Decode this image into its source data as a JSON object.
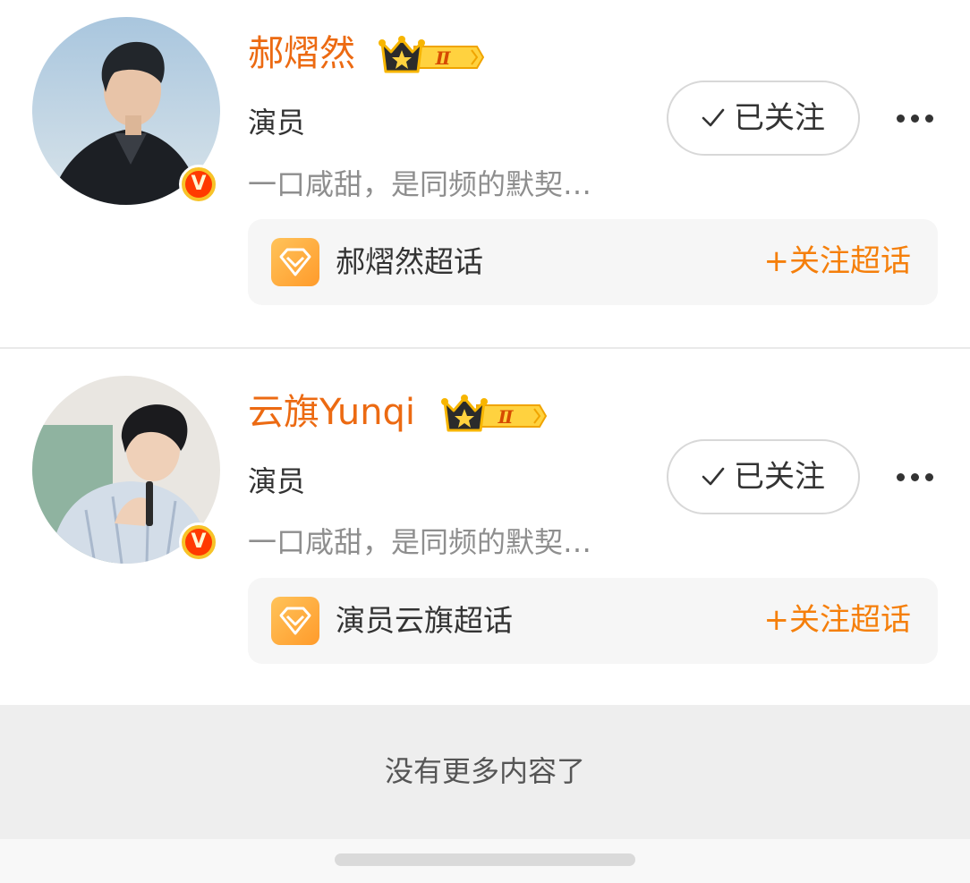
{
  "users": [
    {
      "name": "郝熠然",
      "role": "演员",
      "bio": "一口咸甜，是同频的默契…",
      "level_badge": "Ⅱ",
      "follow_label": "已关注",
      "topic_name": "郝熠然超话",
      "topic_follow_label": "+关注超话"
    },
    {
      "name": "云旗Yunqi",
      "role": "演员",
      "bio": "一口咸甜，是同频的默契…",
      "level_badge": "Ⅱ",
      "follow_label": "已关注",
      "topic_name": "演员云旗超话",
      "topic_follow_label": "+关注超话"
    }
  ],
  "footer": {
    "end_text": "没有更多内容了"
  },
  "colors": {
    "name": "#ec6a12",
    "accent": "#f57f0b",
    "verified_badge": "#ff3a00"
  }
}
